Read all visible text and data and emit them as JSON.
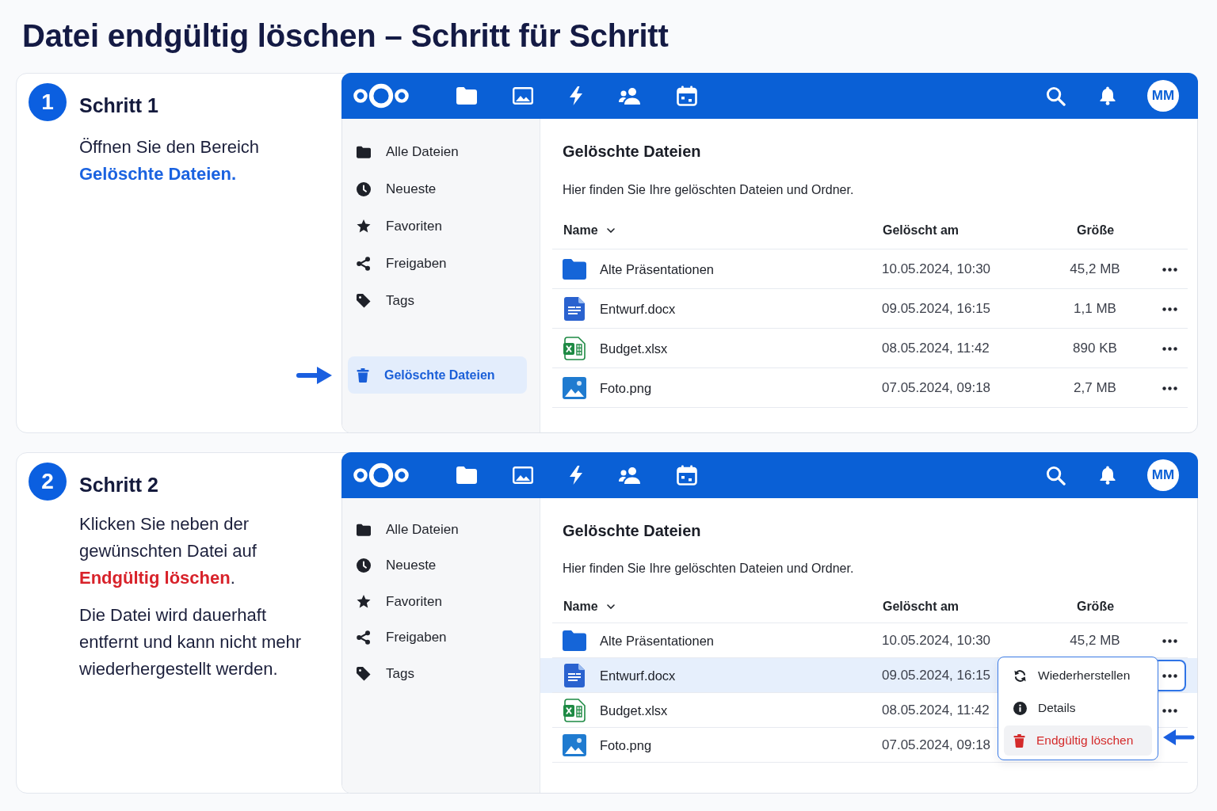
{
  "title": "Datei endgültig löschen – Schritt für Schritt",
  "steps": [
    {
      "number": "1",
      "title": "Schritt 1",
      "kind": "open",
      "paragraphs": [
        "Öffnen Sie den Bereich **Gelöschte Dateien.**"
      ],
      "app": {
        "avatar": "MM",
        "sidebar": {
          "items": [
            {
              "label": "Alle Dateien",
              "kind": "folder",
              "selected": false
            },
            {
              "label": "Neueste",
              "kind": "recent",
              "selected": false
            },
            {
              "label": "Favoriten",
              "kind": "favorite",
              "selected": false
            },
            {
              "label": "Freigaben",
              "kind": "shared",
              "selected": false
            },
            {
              "label": "Tags",
              "kind": "tags",
              "selected": false
            }
          ],
          "footer_items": [
            {
              "label": "Gelöschte Dateien",
              "kind": "trash",
              "selected": true
            }
          ]
        },
        "heading": "Gelöschte Dateien",
        "description": "Hier finden Sie Ihre gelöschten Dateien und Ordner.",
        "table": {
          "columns": [
            {
              "label": "Name",
              "sorted": true
            },
            {
              "label": "Gelöscht am",
              "sorted": false
            },
            {
              "label": "Größe",
              "sorted": false
            }
          ],
          "rows": [
            {
              "name": "Alte Präsentationen",
              "kind": "folder",
              "deleted": "10.05.2024, 10:30",
              "size": "45,2 MB",
              "selected": false,
              "actions": true,
              "menu_open": false
            },
            {
              "name": "Entwurf.docx",
              "kind": "document",
              "deleted": "09.05.2024, 16:15",
              "size": "1,1 MB",
              "selected": false,
              "actions": true,
              "menu_open": false
            },
            {
              "name": "Budget.xlsx",
              "kind": "spreadsheet",
              "deleted": "08.05.2024, 11:42",
              "size": "890 KB",
              "selected": false,
              "actions": true,
              "menu_open": false
            },
            {
              "name": "Foto.png",
              "kind": "image",
              "deleted": "07.05.2024, 09:18",
              "size": "2,7 MB",
              "selected": false,
              "actions": true,
              "menu_open": false
            }
          ]
        }
      }
    },
    {
      "number": "2",
      "title": "Schritt 2",
      "kind": "delete",
      "paragraphs": [
        "Klicken Sie neben der gewünschten Datei auf **Endgültig löschen**.",
        "Die Datei wird dauerhaft entfernt und kann nicht mehr wiederhergestellt werden."
      ],
      "app": {
        "avatar": "MM",
        "sidebar": {
          "items": [
            {
              "label": "Alle Dateien",
              "kind": "folder",
              "selected": false
            },
            {
              "label": "Neueste",
              "kind": "recent",
              "selected": false
            },
            {
              "label": "Favoriten",
              "kind": "favorite",
              "selected": false
            },
            {
              "label": "Freigaben",
              "kind": "shared",
              "selected": false
            },
            {
              "label": "Tags",
              "kind": "tags",
              "selected": false
            }
          ]
        },
        "heading": "Gelöschte Dateien",
        "description": "Hier finden Sie Ihre gelöschten Dateien und Ordner.",
        "table": {
          "columns": [
            {
              "label": "Name",
              "sorted": true
            },
            {
              "label": "Gelöscht am",
              "sorted": false
            },
            {
              "label": "Größe",
              "sorted": false
            }
          ],
          "rows": [
            {
              "name": "Alte Präsentationen",
              "kind": "folder",
              "deleted": "10.05.2024, 10:30",
              "size": "45,2 MB",
              "selected": false,
              "actions": true,
              "menu_open": false
            },
            {
              "name": "Entwurf.docx",
              "kind": "document",
              "deleted": "09.05.2024, 16:15",
              "selected": true,
              "actions": true,
              "menu_open": true
            },
            {
              "name": "Budget.xlsx",
              "kind": "spreadsheet",
              "deleted": "08.05.2024, 11:42",
              "selected": false,
              "actions": true,
              "menu_open": false
            },
            {
              "name": "Foto.png",
              "kind": "image",
              "deleted": "07.05.2024, 09:18",
              "selected": false,
              "actions": false,
              "menu_open": false
            }
          ]
        },
        "context_menu": {
          "items": [
            {
              "label": "Wiederherstellen",
              "kind": "restore",
              "selected": false
            },
            {
              "label": "Details",
              "kind": "details",
              "selected": false
            },
            {
              "label": "Endgültig löschen",
              "kind": "delete",
              "selected": true
            }
          ]
        }
      }
    }
  ]
}
